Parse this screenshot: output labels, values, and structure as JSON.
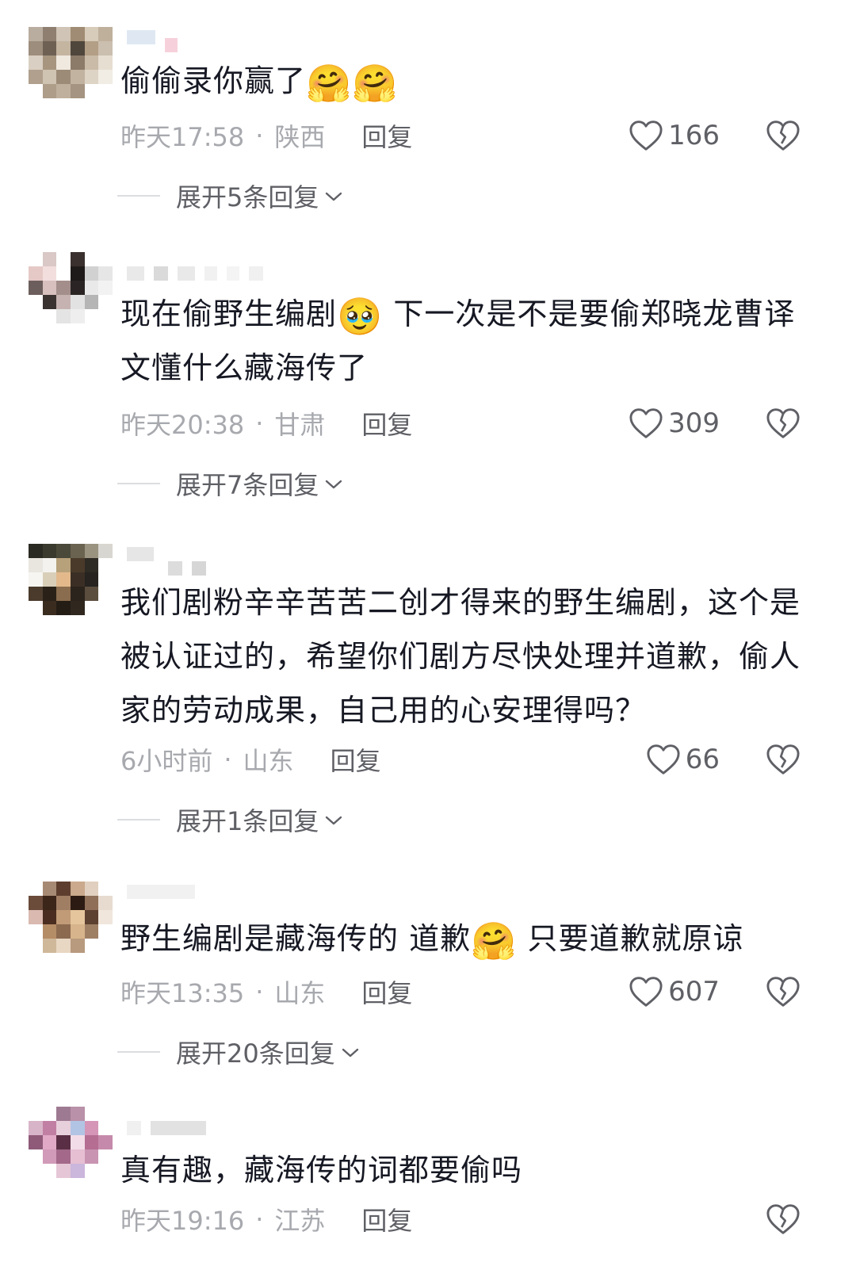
{
  "comments": [
    {
      "text": "偷偷录你赢了",
      "emojis": [
        "🤗",
        "🤗"
      ],
      "time": "昨天17:58",
      "location": "陕西",
      "reply_label": "回复",
      "likes": "166",
      "expand_label": "展开5条回复"
    },
    {
      "text_before": "现在偷野生编剧",
      "emoji_mid": "🥹",
      "text_after": "下一次是不是要偷郑晓龙曹译文懂什么藏海传了",
      "time": "昨天20:38",
      "location": "甘肃",
      "reply_label": "回复",
      "likes": "309",
      "expand_label": "展开7条回复"
    },
    {
      "text": "我们剧粉辛辛苦苦二创才得来的野生编剧，这个是被认证过的，希望你们剧方尽快处理并道歉，偷人家的劳动成果，自己用的心安理得吗？",
      "time": "6小时前",
      "location": "山东",
      "reply_label": "回复",
      "likes": "66",
      "expand_label": "展开1条回复"
    },
    {
      "text_before": "野生编剧是藏海传的 道歉",
      "emoji_mid": "🤗",
      "text_after": "只要道歉就原谅",
      "time": "昨天13:35",
      "location": "山东",
      "reply_label": "回复",
      "likes": "607",
      "expand_label": "展开20条回复"
    },
    {
      "text": "真有趣，藏海传的词都要偷吗",
      "time": "昨天19:16",
      "location": "江苏",
      "reply_label": "回复"
    }
  ],
  "separator": "·",
  "icons": {
    "like": "heart-outline-icon",
    "dislike": "broken-heart-icon",
    "expand": "chevron-down-icon"
  },
  "colors": {
    "text": "#161823",
    "meta": "#a7a9ae",
    "action": "#5f6066"
  }
}
